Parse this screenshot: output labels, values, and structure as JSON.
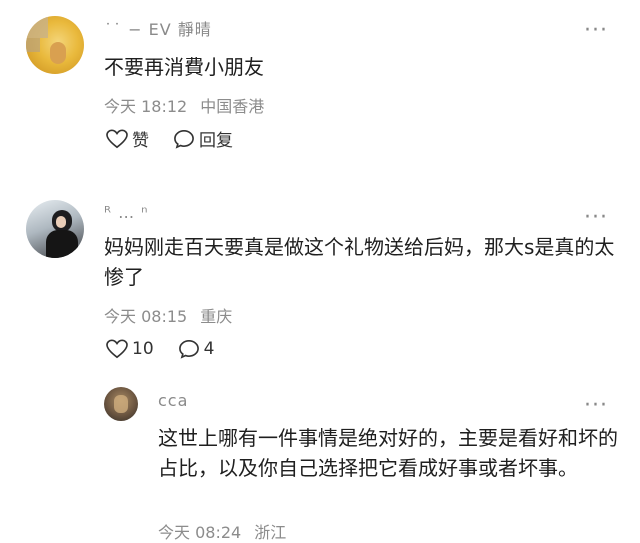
{
  "comments": [
    {
      "name": "˙˙ − EV 靜晴",
      "text": "不要再消費小朋友",
      "time": "今天 18:12",
      "location": "中国香港",
      "like_label": "赞",
      "reply_label": "回复"
    },
    {
      "name": "ᴿ … ⁿ",
      "text": "妈妈刚走百天要真是做这个礼物送给后妈，那大s是真的太惨了",
      "time": "今天 08:15",
      "location": "重庆",
      "like_count": "10",
      "reply_count": "4"
    },
    {
      "name": "cca",
      "text": "这世上哪有一件事情是绝对好的，主要是看好和坏的占比，以及你自己选择把它看成好事或者坏事。",
      "time": "今天 08:24",
      "location": "浙江"
    }
  ],
  "more_icon": "more-dots-icon",
  "colors": {
    "meta": "#8c8c8c",
    "text": "#1f1f1f"
  }
}
